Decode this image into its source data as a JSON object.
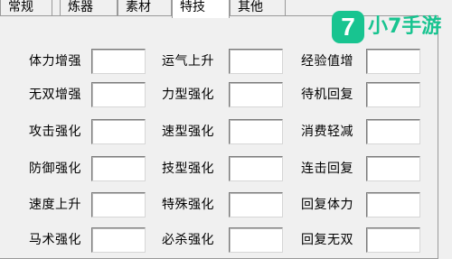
{
  "tabs": [
    "常规",
    "炼器",
    "素材",
    "特技",
    "其他"
  ],
  "active_tab": "特技",
  "watermark": {
    "badge": "7",
    "text": "小7手游"
  },
  "fields": {
    "col1": [
      "体力增强",
      "无双增强",
      "攻击强化",
      "防御强化",
      "速度上升",
      "马术强化"
    ],
    "col2": [
      "运气上升",
      "力型强化",
      "速型强化",
      "技型强化",
      "特殊强化",
      "必杀强化"
    ],
    "col3": [
      "经验值增",
      "待机回复",
      "消费轻减",
      "连击回复",
      "回复体力",
      "回复无双"
    ]
  },
  "values": {
    "col1": [
      "",
      "",
      "",
      "",
      "",
      ""
    ],
    "col2": [
      "",
      "",
      "",
      "",
      "",
      ""
    ],
    "col3": [
      "",
      "",
      "",
      "",
      "",
      ""
    ]
  }
}
